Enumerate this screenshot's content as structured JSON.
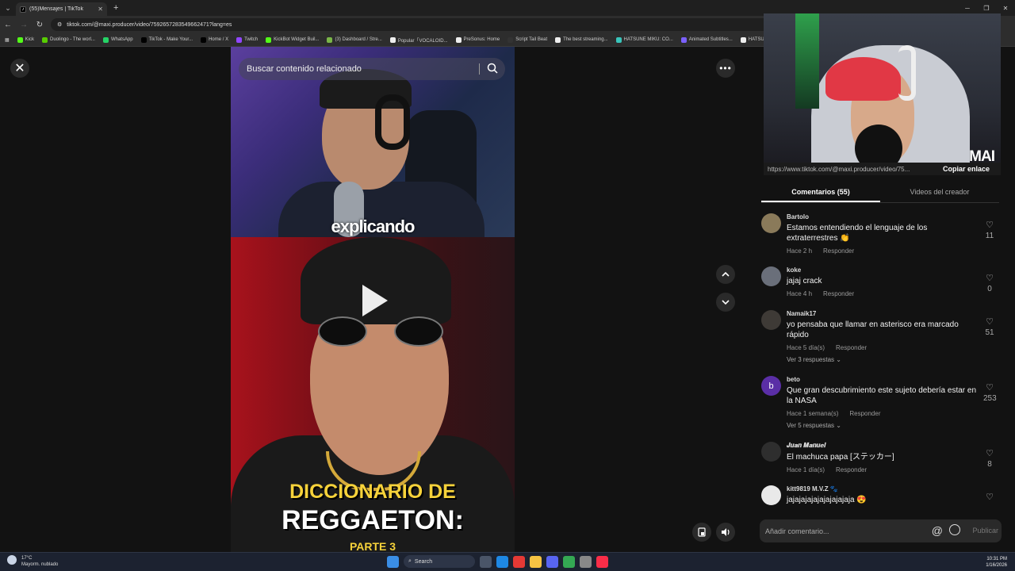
{
  "browser": {
    "tab_title": "(55)Mensajes | TikTok",
    "url": "tiktok.com/@maxi.producer/video/7592657283549662471?lang=es",
    "bookmarks": [
      {
        "label": "Kick",
        "color": "#53fc18"
      },
      {
        "label": "Duolingo - The worl...",
        "color": "#58cc02"
      },
      {
        "label": "WhatsApp",
        "color": "#25d366"
      },
      {
        "label": "TikTok - Make Your...",
        "color": "#000000"
      },
      {
        "label": "Home / X",
        "color": "#000000"
      },
      {
        "label": "Twitch",
        "color": "#9146ff"
      },
      {
        "label": "KickBot Widget Buil...",
        "color": "#53fc18"
      },
      {
        "label": "(3) Dashboard / Stre...",
        "color": "#7ab648"
      },
      {
        "label": "Popular「VOCALOID...",
        "color": "#eeeeee"
      },
      {
        "label": "PreSonus: Home",
        "color": "#eeeeee"
      },
      {
        "label": "Script Tail Beat",
        "color": "#333333"
      },
      {
        "label": "The best streaming...",
        "color": "#eeeeee"
      },
      {
        "label": "HATSUNE MIKU: CO...",
        "color": "#39c5bb"
      },
      {
        "label": "Animated Subtitles...",
        "color": "#7b61ff"
      },
      {
        "label": "HATSUNE MI...",
        "color": "#eeeeee"
      }
    ]
  },
  "video": {
    "search_placeholder": "Buscar contenido relacionado",
    "caption": "explicando",
    "title_line1": "DICCIONARIO DE",
    "title_line2": "REGGAETON:",
    "title_line3": "PARTE 3"
  },
  "overlay": {
    "share_url": "https://www.tiktok.com/@maxi.producer/video/75...",
    "copy_label": "Copiar enlace",
    "logo": "MAI"
  },
  "panel": {
    "tabs": [
      {
        "label": "Comentarios (55)",
        "active": true
      },
      {
        "label": "Videos del creador",
        "active": false
      }
    ],
    "reply_label": "Responder",
    "comments": [
      {
        "user": "Bartolo",
        "text": "Estamos entendiendo el lenguaje de los extraterrestres 👏",
        "time": "Hace 2 h",
        "likes": "11",
        "replies": "",
        "avatar_color": "#8a7a5a",
        "avatar_letter": ""
      },
      {
        "user": "koke",
        "text": "jajaj crack",
        "time": "Hace 4 h",
        "likes": "0",
        "replies": "",
        "avatar_color": "#6a6f7a",
        "avatar_letter": ""
      },
      {
        "user": "Namaik17",
        "text": "yo pensaba que llamar en asterisco era marcado rápido",
        "time": "Hace 5 día(s)",
        "likes": "51",
        "replies": "Ver 3 respuestas ⌄",
        "avatar_color": "#3e3a36",
        "avatar_letter": ""
      },
      {
        "user": "beto",
        "text": "Que gran descubrimiento este sujeto debería estar en la NASA",
        "time": "Hace 1 semana(s)",
        "likes": "253",
        "replies": "Ver 5 respuestas ⌄",
        "avatar_color": "#5a2ea6",
        "avatar_letter": "b"
      },
      {
        "user": "𝑱𝒖𝒂𝒏 𝑴𝒂𝒏𝒖𝒆𝒍",
        "text": "El machuca papa [ステッカー]",
        "time": "Hace 1 día(s)",
        "likes": "8",
        "replies": "",
        "avatar_color": "#2e2e2e",
        "avatar_letter": ""
      },
      {
        "user": "kitt9819 M.V.Z 🐾",
        "text": "jajajajajajajajajajaja 😍",
        "time": "",
        "likes": "",
        "replies": "",
        "avatar_color": "#e9e9e9",
        "avatar_letter": ""
      }
    ],
    "comment_placeholder": "Añadir comentario...",
    "publish_label": "Publicar"
  },
  "taskbar": {
    "temperature": "17°C",
    "weather": "Mayorm. nublado",
    "search_label": "Search",
    "time": "10:31 PM",
    "date": "1/16/2026"
  }
}
